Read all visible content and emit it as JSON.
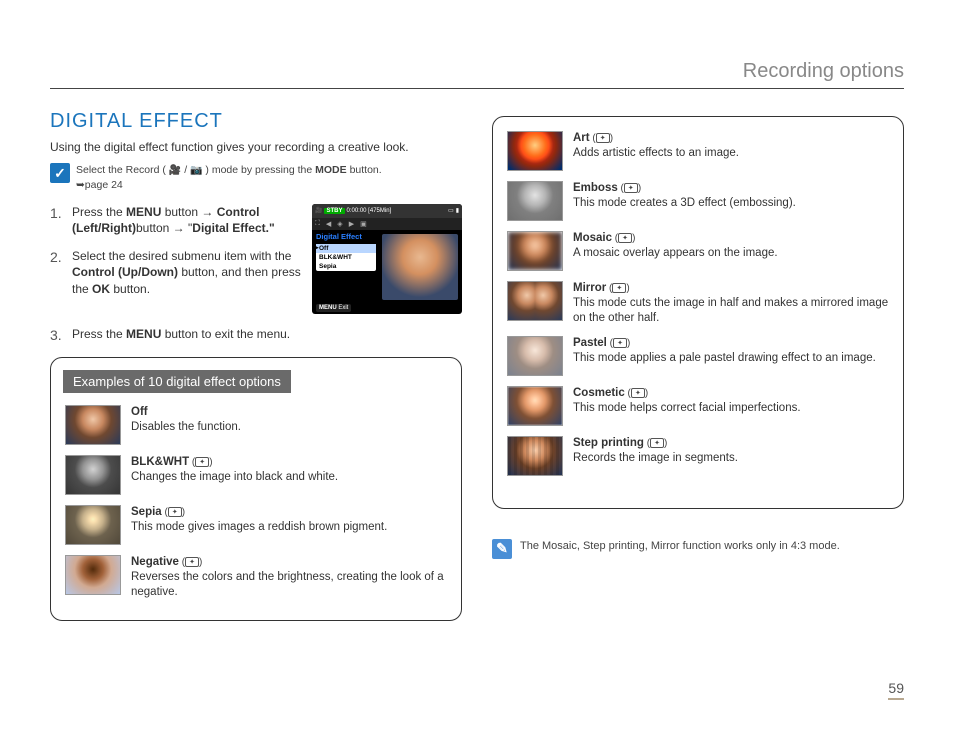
{
  "header": {
    "title": "Recording options"
  },
  "section": {
    "title": "DIGITAL EFFECT"
  },
  "intro": "Using the digital effect function gives your recording a creative look.",
  "tip": {
    "prefix": "Select the Record (",
    "mid": " / ",
    "suffix": ") mode by pressing the ",
    "mode_word": "MODE",
    "after": " button.",
    "page_ref": "➥page 24"
  },
  "steps": [
    {
      "num": "1.",
      "parts": {
        "a": "Press the ",
        "b": "MENU",
        "c": " button → ",
        "d": "Control (Left/Right)",
        "e": "button → \"",
        "f": "Digital Effect.\""
      }
    },
    {
      "num": "2.",
      "parts": {
        "a": "Select the desired submenu item with the ",
        "b": "Control (Up/Down)",
        "c": " button, and then press the ",
        "d": "OK",
        "e": " button."
      }
    },
    {
      "num": "3.",
      "parts": {
        "a": "Press the ",
        "b": "MENU",
        "c": " button to exit the menu."
      }
    }
  ],
  "screen": {
    "stby": "STBY",
    "time": "0:00:00 [475Min]",
    "menu_title": "Digital Effect",
    "opts": [
      "Off",
      "BLK&WHT",
      "Sepia"
    ],
    "exit_label": "Exit",
    "exit_btn": "MENU"
  },
  "examples_header": "Examples of 10 digital effect options",
  "effects_left": [
    {
      "key": "off",
      "name": "Off",
      "has_icon": false,
      "desc": "Disables the function."
    },
    {
      "key": "bw",
      "name": "BLK&WHT",
      "has_icon": true,
      "desc": "Changes the image into black and white."
    },
    {
      "key": "sepia",
      "name": "Sepia",
      "has_icon": true,
      "desc": "This mode gives images a reddish brown pigment."
    },
    {
      "key": "neg",
      "name": "Negative",
      "has_icon": true,
      "desc": "Reverses the colors and the brightness, creating the look of a negative."
    }
  ],
  "effects_right": [
    {
      "key": "art",
      "name": "Art",
      "has_icon": true,
      "desc": "Adds artistic effects to an image."
    },
    {
      "key": "emboss",
      "name": "Emboss",
      "has_icon": true,
      "desc": "This mode creates a 3D effect (embossing)."
    },
    {
      "key": "mosaic",
      "name": "Mosaic",
      "has_icon": true,
      "desc": "A mosaic overlay appears on the image."
    },
    {
      "key": "mirror",
      "name": "Mirror",
      "has_icon": true,
      "desc": "This mode cuts the image in half and makes a mirrored image on the other half."
    },
    {
      "key": "pastel",
      "name": "Pastel",
      "has_icon": true,
      "desc": "This mode applies a pale pastel drawing effect to an image."
    },
    {
      "key": "cosm",
      "name": "Cosmetic",
      "has_icon": true,
      "desc": "This mode helps correct facial imperfections."
    },
    {
      "key": "step",
      "name": "Step printing",
      "has_icon": true,
      "desc": "Records the image in segments."
    }
  ],
  "note": "The Mosaic, Step printing, Mirror function works only in 4:3 mode.",
  "page_number": "59"
}
